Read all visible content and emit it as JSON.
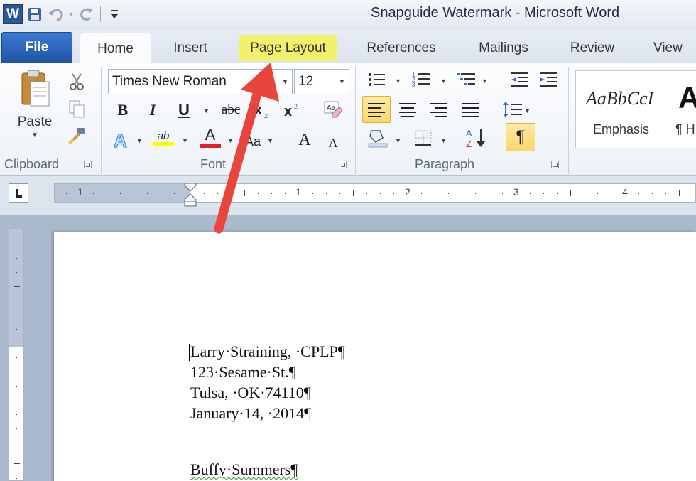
{
  "window": {
    "title": "Snapguide Watermark  -  Microsoft Word"
  },
  "quick_access": {
    "app_icon_letter": "W",
    "buttons": [
      "save-icon",
      "undo-icon",
      "redo-icon",
      "customize-qat-icon"
    ]
  },
  "tabs": {
    "file": "File",
    "home": "Home",
    "insert": "Insert",
    "page_layout": "Page Layout",
    "references": "References",
    "mailings": "Mailings",
    "review": "Review",
    "view": "View"
  },
  "highlight_color": "#f3f16a",
  "ribbon": {
    "clipboard": {
      "label": "Clipboard",
      "paste_label": "Paste"
    },
    "font": {
      "label": "Font",
      "font_name": "Times New Roman",
      "font_size": "12",
      "bold": "B",
      "italic": "I",
      "underline": "U",
      "strikethrough": "abc",
      "grow_font": "A",
      "shrink_font": "A",
      "change_case": "Aa",
      "font_color": "A",
      "highlight": "ab"
    },
    "paragraph": {
      "label": "Paragraph",
      "show_marks": "¶"
    },
    "styles": {
      "sample_emphasis": "AaBbCcI",
      "name_emphasis": "Emphasis",
      "sample_heading": "A",
      "name_heading": "¶ H"
    }
  },
  "ruler": {
    "numbers": [
      "1",
      "1",
      "2",
      "3",
      "4"
    ]
  },
  "document": {
    "lines": [
      "Larry·Straining, ·CPLP¶",
      "123·Sesame·St.¶",
      "Tulsa, ·OK·74110¶",
      "January·14, ·2014¶",
      "Buffy·Summers¶"
    ]
  },
  "annotation": {
    "arrow_color": "#e8453c",
    "points_to": "Page Layout"
  }
}
